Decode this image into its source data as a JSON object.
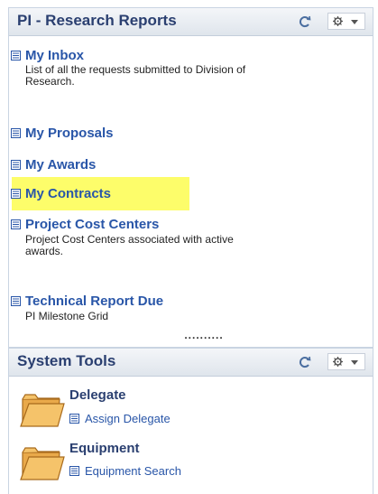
{
  "research_panel": {
    "title": "PI - Research Reports",
    "links": [
      {
        "label": "My Inbox",
        "description": [
          "List of all the requests submitted to Division of",
          "Research."
        ]
      },
      {
        "label": "My Proposals"
      },
      {
        "label": "My Awards"
      },
      {
        "label": "My Contracts",
        "highlighted": true
      },
      {
        "label": "Project Cost Centers",
        "description": [
          "Project Cost Centers associated with active",
          "awards."
        ]
      },
      {
        "label": "Technical Report Due",
        "description": [
          "PI Milestone Grid"
        ]
      }
    ]
  },
  "separator": "..........",
  "tools_panel": {
    "title": "System Tools",
    "folders": [
      {
        "title": "Delegate",
        "link": "Assign Delegate"
      },
      {
        "title": "Equipment",
        "link": "Equipment Search"
      }
    ]
  },
  "colors": {
    "header_title": "#2a3f70",
    "link": "#2956a8",
    "highlight": "#fdfd6a",
    "folder": "#f5c36a"
  },
  "icons": {
    "refresh": "refresh-icon",
    "gear": "gear-icon",
    "menu": "chevron-down-icon",
    "list": "list-icon",
    "folder": "folder-icon"
  }
}
